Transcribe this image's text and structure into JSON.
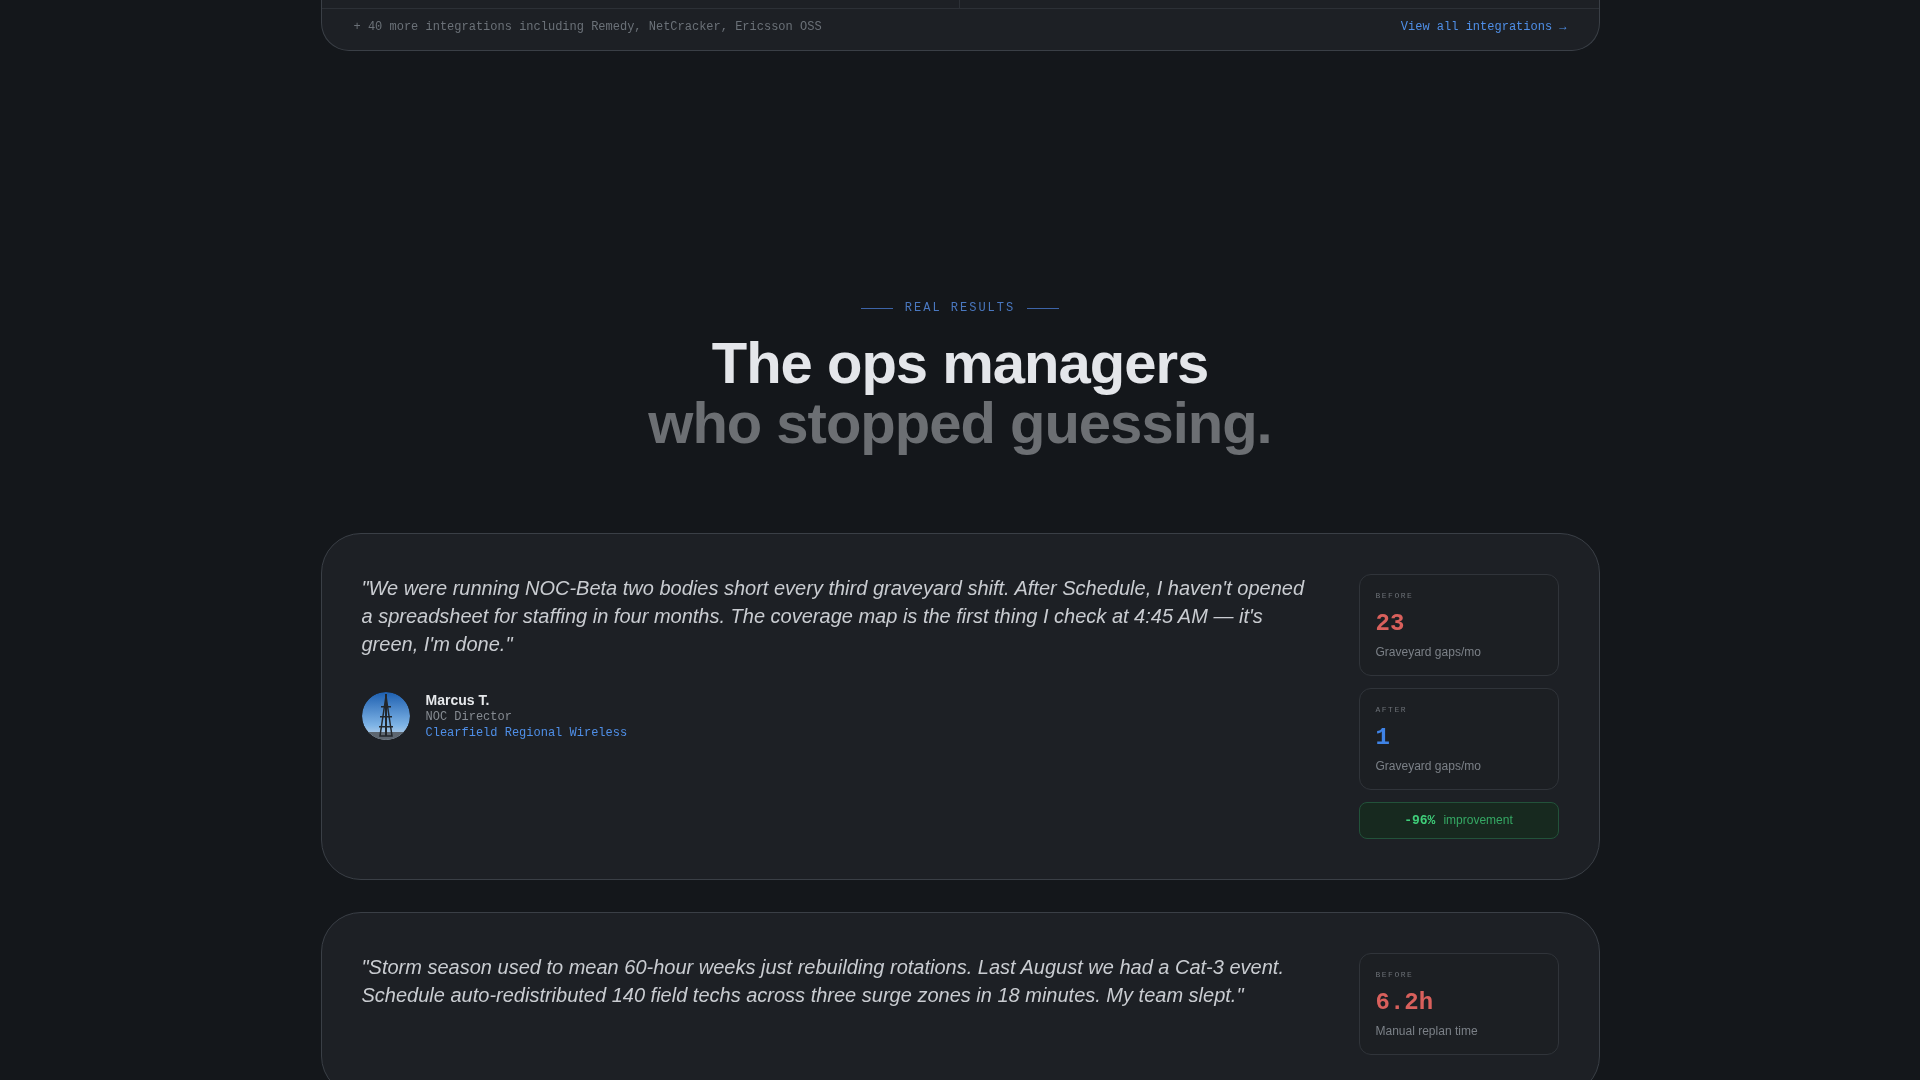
{
  "integrations_footer": {
    "note": "+ 40 more integrations including Remedy, NetCracker, Ericsson OSS",
    "link": "View all integrations →"
  },
  "section": {
    "eyebrow": "REAL RESULTS",
    "title_line_1": "The ops managers",
    "title_line_2": "who stopped guessing."
  },
  "testimonials": [
    {
      "quote": "\"We were running NOC-Beta two bodies short every third graveyard shift. After Schedule, I haven't opened a spreadsheet for staffing in four months. The coverage map is the first thing I check at 4:45 AM — it's green, I'm done.\"",
      "author": {
        "name": "Marcus T.",
        "role": "NOC Director",
        "company": "Clearfield Regional Wireless"
      },
      "stats": [
        {
          "kind": "before",
          "label": "BEFORE",
          "value": "23",
          "caption": "Graveyard gaps/mo"
        },
        {
          "kind": "after",
          "label": "AFTER",
          "value": "1",
          "caption": "Graveyard gaps/mo"
        }
      ],
      "improvement": {
        "value": "-96%",
        "label": "improvement"
      }
    },
    {
      "quote": "\"Storm season used to mean 60-hour weeks just rebuilding rotations. Last August we had a Cat-3 event. Schedule auto-redistributed 140 field techs across three surge zones in 18 minutes. My team slept.\"",
      "stats": [
        {
          "kind": "before",
          "label": "BEFORE",
          "value": "6.2h",
          "caption": "Manual replan time"
        }
      ]
    }
  ]
}
